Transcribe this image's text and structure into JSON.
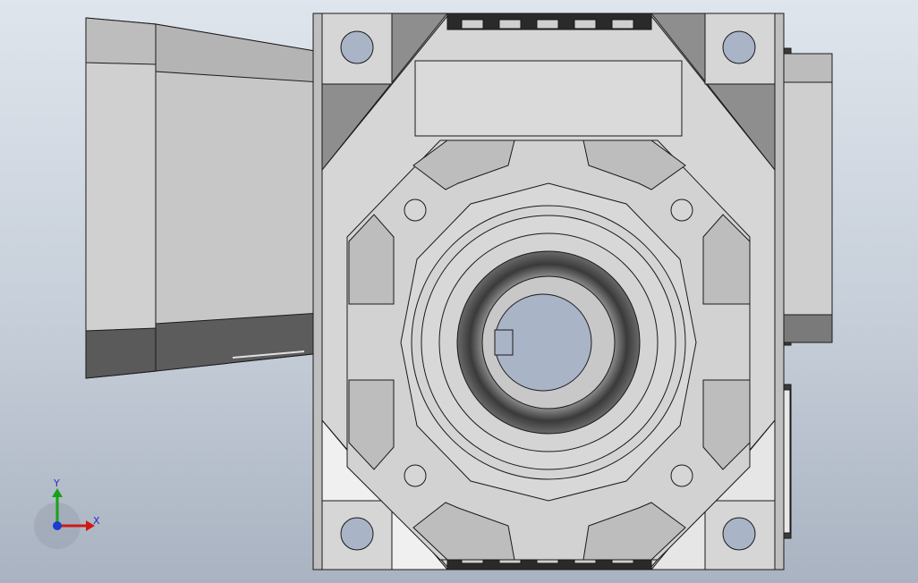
{
  "viewport": {
    "background_top": "#dfe5ec",
    "background_bottom": "#a9b3c1"
  },
  "model": {
    "body_color": "#d6d6d6",
    "shadow_color": "#4a4a4a",
    "edge_color": "#1a1a1a",
    "hole_color": "#a9b4c7"
  },
  "triad": {
    "x_label": "X",
    "y_label": "Y",
    "x_color": "#d01818",
    "y_color": "#18a018",
    "origin_color": "#1a3cd0",
    "label_color": "#2a2ac0"
  }
}
